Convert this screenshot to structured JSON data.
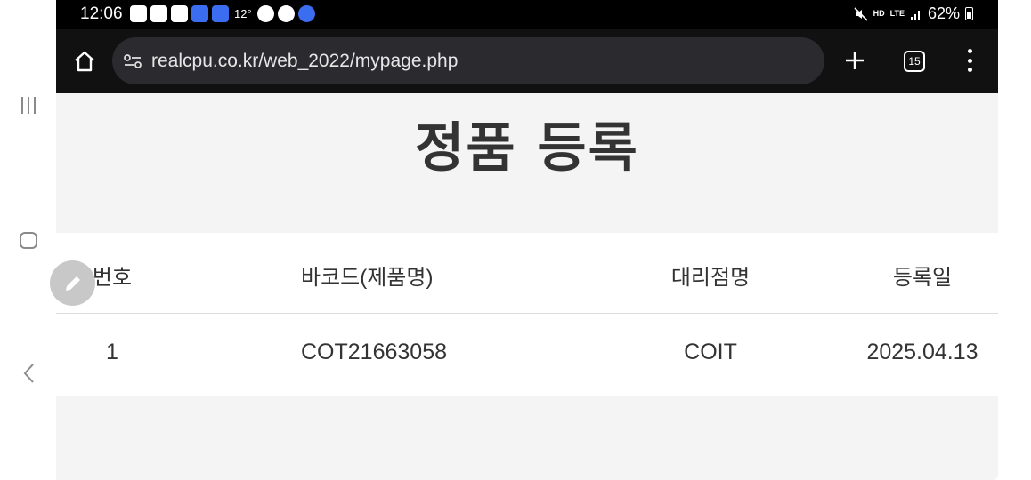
{
  "statusbar": {
    "time": "12:06",
    "temperature": "12°",
    "battery": "62%",
    "network": "LTE",
    "hd_label": "HD",
    "icons": [
      "on-app-icon",
      "news-icon",
      "webtoon-icon",
      "app-blue-icon",
      "app-blue-icon",
      "ap-icon",
      "shield-icon",
      "super-sol-icon"
    ]
  },
  "browser": {
    "url": "realcpu.co.kr/web_2022/mypage.php",
    "tab_count": "15"
  },
  "page": {
    "title": "정품 등록"
  },
  "table": {
    "headers": [
      "번호",
      "바코드(제품명)",
      "대리점명",
      "등록일"
    ],
    "rows": [
      [
        "1",
        "COT21663058",
        "COIT",
        "2025.04.13"
      ]
    ]
  },
  "colors": {
    "accent": "#3a6df0",
    "page_bg": "#f4f4f4",
    "topbar": "#111111"
  }
}
